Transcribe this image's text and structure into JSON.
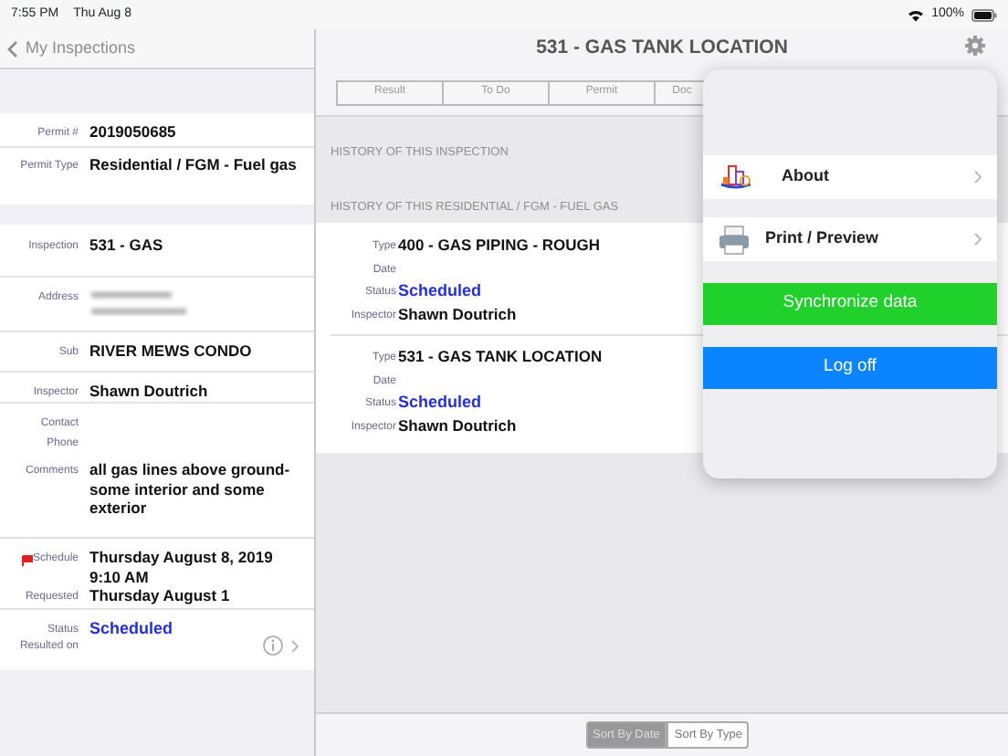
{
  "status_bar": {
    "time": "7:55 PM",
    "date": "Thu Aug 8",
    "battery": "100%"
  },
  "left": {
    "back": "My Inspections",
    "sections": [
      [
        {
          "label": "Permit #",
          "value": "2019050685",
          "kind": "text"
        },
        {
          "label": "Permit Type",
          "value": "Residential / FGM - Fuel gas",
          "kind": "text"
        }
      ],
      [
        {
          "label": "Inspection",
          "value": "531 - GAS",
          "kind": "text"
        },
        {
          "label": "Address",
          "kind": "blurred"
        },
        {
          "label": "Sub",
          "value": "RIVER MEWS CONDO",
          "kind": "text"
        },
        {
          "label": "Inspector",
          "value": "Shawn Doutrich",
          "kind": "text"
        },
        {
          "label": "Contact",
          "kind": "text"
        },
        {
          "label": "Phone",
          "kind": "text"
        },
        {
          "label": "Comments",
          "value": "all gas lines above ground- some interior and some exterior",
          "kind": "text"
        },
        {
          "label": "Schedule",
          "value": "Thursday August 8, 2019 9:10 AM",
          "kind": "text",
          "flagged": true
        },
        {
          "label": "Requested",
          "value": "Thursday August 1",
          "kind": "text",
          "flagged": false
        },
        {
          "label": "Status",
          "value": "Scheduled",
          "kind": "status"
        },
        {
          "label": "Resulted on",
          "kind": "text"
        }
      ]
    ]
  },
  "right": {
    "title": "531 - GAS TANK LOCATION",
    "segments": [
      {
        "label": "Result",
        "selected": false
      },
      {
        "label": "To Do",
        "selected": false
      },
      {
        "label": "Permit",
        "selected": false
      },
      {
        "label": "Doc",
        "selected": false
      }
    ],
    "headers": [
      "HISTORY OF THIS INSPECTION",
      "HISTORY OF THIS RESIDENTIAL / FGM - FUEL GAS"
    ],
    "history": [
      {
        "fields": [
          {
            "label": "Type",
            "value": "400 - GAS PIPING - ROUGH",
            "kind": "text"
          },
          {
            "label": "Date",
            "kind": "text"
          },
          {
            "label": "Status",
            "value": "Scheduled",
            "kind": "status"
          },
          {
            "label": "Inspector",
            "value": "Shawn Doutrich",
            "kind": "text"
          }
        ]
      },
      {
        "fields": [
          {
            "label": "Type",
            "value": "531 - GAS TANK LOCATION",
            "kind": "text"
          },
          {
            "label": "Date",
            "kind": "text"
          },
          {
            "label": "Status",
            "value": "Scheduled",
            "kind": "status"
          },
          {
            "label": "Inspector",
            "value": "Shawn Doutrich",
            "kind": "text"
          }
        ]
      }
    ],
    "sort": [
      {
        "label": "Sort By Date",
        "selected": true
      },
      {
        "label": "Sort By Type",
        "selected": false
      }
    ]
  },
  "menu": [
    {
      "label": "About",
      "kind": "row"
    },
    {
      "label": "Print / Preview",
      "kind": "row"
    },
    {
      "label": "Synchronize data",
      "kind": "button",
      "color": "#1fd12a"
    },
    {
      "label": "Log off",
      "kind": "button",
      "color": "#0a84ff"
    }
  ]
}
